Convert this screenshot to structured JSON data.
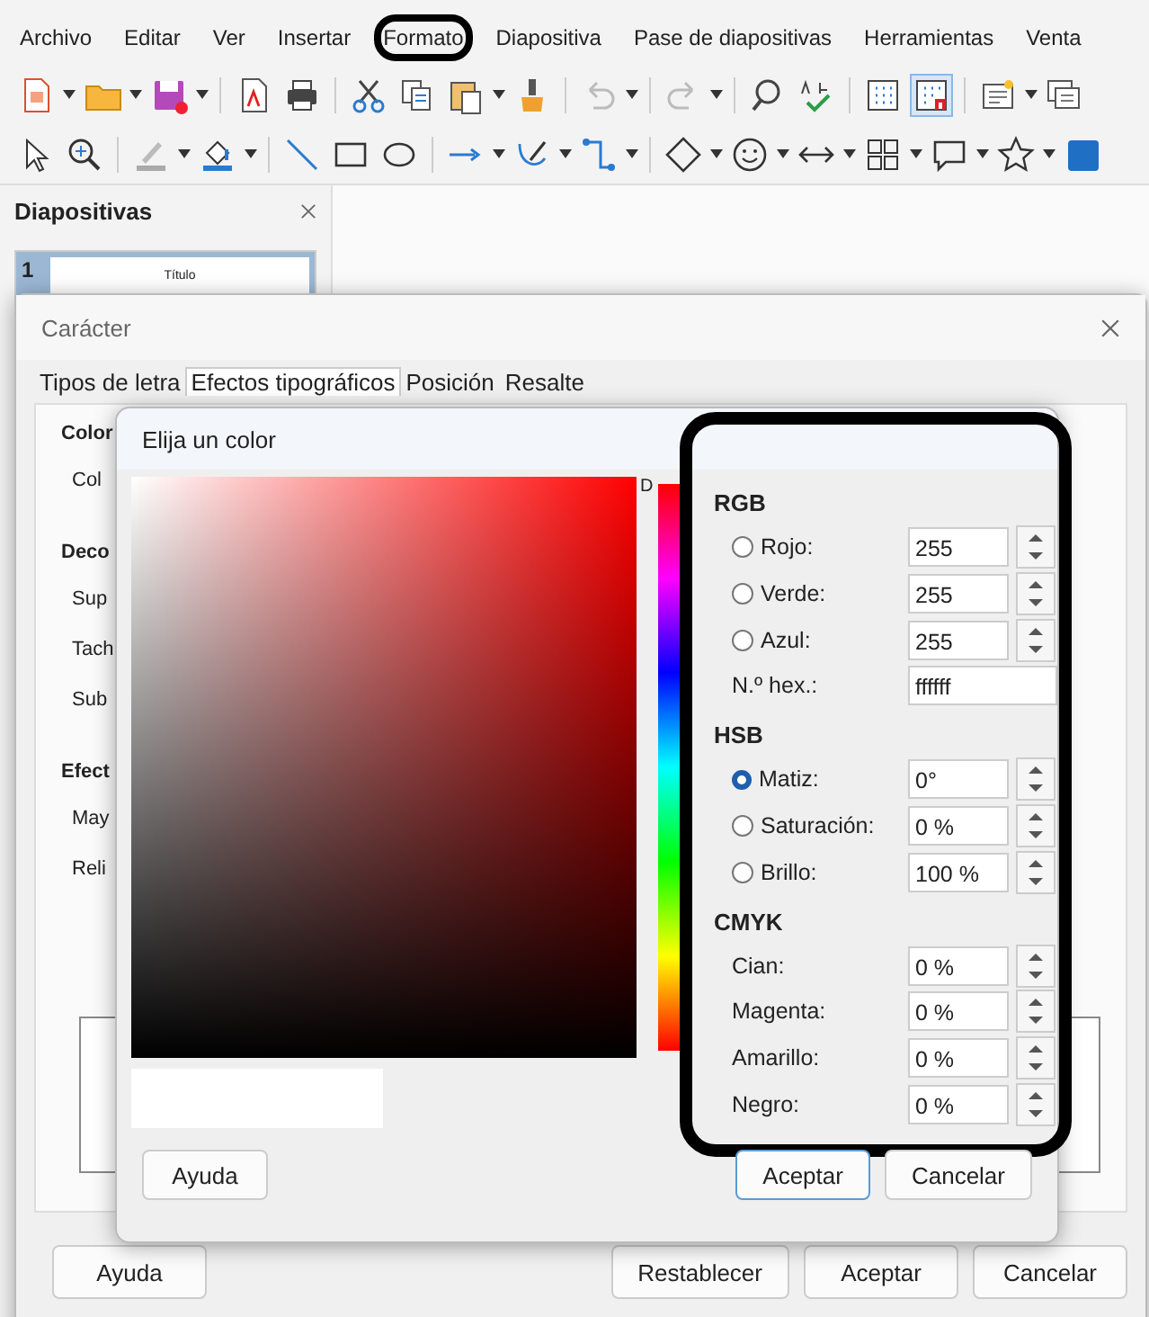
{
  "menu": [
    {
      "label": "Archivo",
      "highlighted": false
    },
    {
      "label": "Editar",
      "highlighted": false
    },
    {
      "label": "Ver",
      "highlighted": false
    },
    {
      "label": "Insertar",
      "highlighted": false
    },
    {
      "label": "Formato",
      "highlighted": true
    },
    {
      "label": "Diapositiva",
      "highlighted": false
    },
    {
      "label": "Pase de diapositivas",
      "highlighted": false
    },
    {
      "label": "Herramientas",
      "highlighted": false
    },
    {
      "label": "Venta",
      "highlighted": false
    }
  ],
  "slides_panel": {
    "title": "Diapositivas",
    "slides": [
      {
        "number": "1",
        "title": "Título",
        "selected": true
      }
    ]
  },
  "character_dialog": {
    "title": "Carácter",
    "tabs": [
      {
        "label": "Tipos de letra",
        "selected": false
      },
      {
        "label": "Efectos tipográficos",
        "selected": true
      },
      {
        "label": "Posición",
        "selected": false
      },
      {
        "label": "Resalte",
        "selected": false
      }
    ],
    "sections": [
      {
        "heading": "Color",
        "items": [
          "Col"
        ]
      },
      {
        "heading": "Deco",
        "items": [
          "Sup",
          "Tach",
          "Sub"
        ]
      },
      {
        "heading": "Efect",
        "items": [
          "May",
          "Reli"
        ]
      }
    ],
    "buttons": [
      {
        "label": "Ayuda",
        "default": false
      },
      {
        "label": "Restablecer",
        "default": false
      },
      {
        "label": "Aceptar",
        "default": false
      },
      {
        "label": "Cancelar",
        "default": false
      }
    ]
  },
  "color_dialog": {
    "title": "Elija un color",
    "hue_label": "D",
    "highlighted": true,
    "groups": [
      {
        "heading": "RGB",
        "fields": [
          {
            "kind": "radio",
            "label": "Rojo:",
            "value": "255",
            "selected": false
          },
          {
            "kind": "radio",
            "label": "Verde:",
            "value": "255",
            "selected": false
          },
          {
            "kind": "radio",
            "label": "Azul:",
            "value": "255",
            "selected": false
          },
          {
            "kind": "text",
            "label": "N.º hex.:",
            "value": "ffffff"
          }
        ]
      },
      {
        "heading": "HSB",
        "fields": [
          {
            "kind": "radio",
            "label": "Matiz:",
            "value": "0°",
            "selected": true
          },
          {
            "kind": "radio",
            "label": "Saturación:",
            "value": "0 %",
            "selected": false
          },
          {
            "kind": "radio",
            "label": "Brillo:",
            "value": "100 %",
            "selected": false
          }
        ]
      },
      {
        "heading": "CMYK",
        "fields": [
          {
            "kind": "spin",
            "label": "Cian:",
            "value": "0 %"
          },
          {
            "kind": "spin",
            "label": "Magenta:",
            "value": "0 %"
          },
          {
            "kind": "spin",
            "label": "Amarillo:",
            "value": "0 %"
          },
          {
            "kind": "spin",
            "label": "Negro:",
            "value": "0 %"
          }
        ]
      }
    ],
    "buttons": [
      {
        "label": "Ayuda",
        "default": false
      },
      {
        "label": "Aceptar",
        "default": true
      },
      {
        "label": "Cancelar",
        "default": false
      }
    ]
  }
}
